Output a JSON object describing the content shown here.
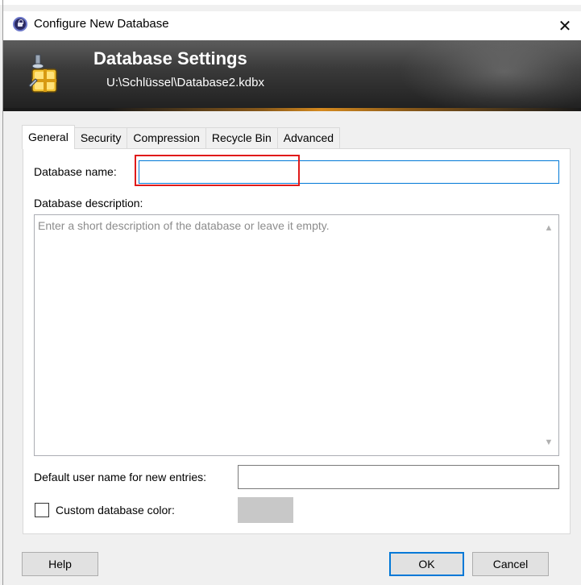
{
  "window": {
    "title": "Configure New Database",
    "close_symbol": "✕"
  },
  "banner": {
    "title": "Database Settings",
    "path": "U:\\Schlüssel\\Database2.kdbx",
    "icon": "database-settings-icon"
  },
  "tabs": [
    {
      "label": "General",
      "active": true
    },
    {
      "label": "Security",
      "active": false
    },
    {
      "label": "Compression",
      "active": false
    },
    {
      "label": "Recycle Bin",
      "active": false
    },
    {
      "label": "Advanced",
      "active": false
    }
  ],
  "general": {
    "name_label": "Database name:",
    "name_value": "",
    "description_label": "Database description:",
    "description_placeholder": "Enter a short description of the database or leave it empty.",
    "description_value": "",
    "default_user_label": "Default user name for new entries:",
    "default_user_value": "",
    "custom_color_label": "Custom database color:",
    "custom_color_checked": false,
    "custom_color_swatch": "#c8c8c8"
  },
  "buttons": {
    "help": "Help",
    "ok": "OK",
    "cancel": "Cancel"
  },
  "colors": {
    "focus_border": "#0078d7",
    "highlight": "#e01a1a",
    "banner_accent": "#d58a1f"
  }
}
